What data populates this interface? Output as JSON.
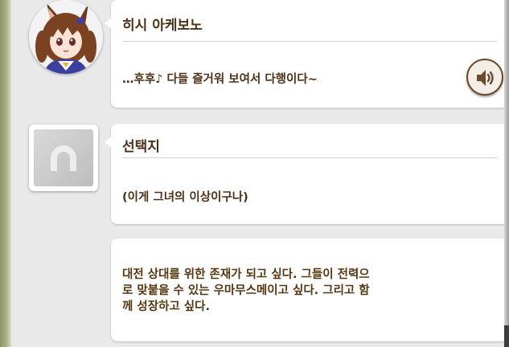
{
  "dialogue": [
    {
      "speaker": "히시 아케보노",
      "line": "…후후♪ 다들 즐거워 보여서 다행이다~"
    },
    {
      "speaker": "선택지",
      "line": "(이게 그녀의 이상이구나)"
    }
  ],
  "narration": {
    "lines": [
      "대전 상대를 위한 존재가 되고 싶다. 그들이 전력으",
      "로 맞붙을 수 있는 우마무스메이고 싶다. 그리고 함",
      "께 성장하고 싶다."
    ]
  },
  "icons": {
    "voice": "speaker-icon",
    "choice": "horseshoe-icon"
  },
  "colors": {
    "text": "#4e3016",
    "divider": "#d7d1c9",
    "bubble": "#ffffff",
    "background": "#e9e9e9"
  }
}
